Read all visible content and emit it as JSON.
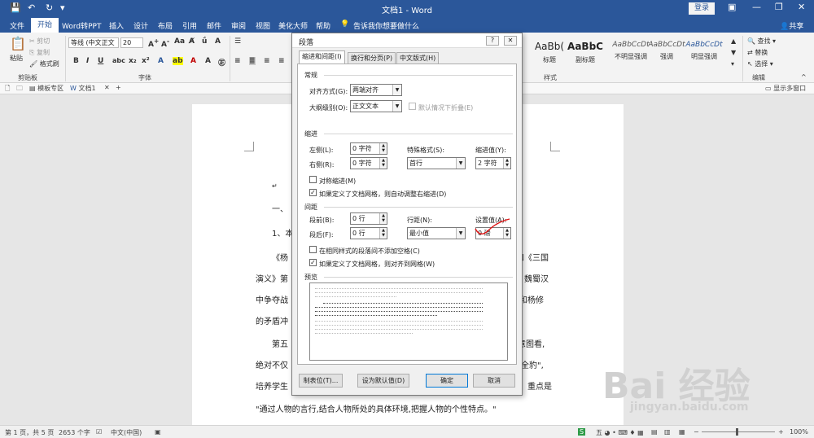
{
  "titlebar": {
    "title": "文档1 - Word",
    "login": "登录"
  },
  "ribbon_tabs": [
    "文件",
    "开始",
    "Word转PPT",
    "插入",
    "设计",
    "布局",
    "引用",
    "邮件",
    "审阅",
    "视图",
    "美化大师",
    "帮助"
  ],
  "tell_me": "告诉我你想要做什么",
  "share": "共享",
  "ribbon": {
    "paste": "粘贴",
    "cut": "剪切",
    "copy": "复制",
    "format_painter": "格式刷",
    "clipboard_label": "剪贴板",
    "font_name": "等线 (中文正文",
    "font_size": "20",
    "font_label": "字体",
    "styles_label": "样式",
    "edit_label": "编辑",
    "find": "查找",
    "replace": "替换",
    "select": "选择",
    "styles": [
      {
        "sample": "AaBb(",
        "name": "标题"
      },
      {
        "sample": "AaBbC",
        "name": "副标题"
      },
      {
        "sample": "AaBbCcDt",
        "name": "不明显强调"
      },
      {
        "sample": "AaBbCcDt",
        "name": "强调"
      },
      {
        "sample": "AaBbCcDt",
        "name": "明显强调"
      }
    ]
  },
  "docbar": {
    "templates": "模板专区",
    "doc": "文档1",
    "multi_window": "显示多窗口"
  },
  "document": {
    "l1": "一、",
    "l2": "1、本",
    "l3a": "《杨",
    "l3b": "和《三国",
    "l4a": "演义》第",
    "l4b": "魏蜀汉",
    "l5a": "中争夺战",
    "l5b": "和杨修",
    "l6a": "的矛盾冲",
    "l7a": "第五",
    "l7b": "意图看,",
    "l8a": "绝对不仅",
    "l8b": "全豹\",",
    "l9a": "培养学生",
    "l9b": "重点是",
    "l10": "\"通过人物的言行,结合人物所处的具体环境,把握人物的个性特点。\""
  },
  "dialog": {
    "title": "段落",
    "help": "?",
    "close": "✕",
    "tabs": [
      "缩进和间距(I)",
      "换行和分页(P)",
      "中文版式(H)"
    ],
    "general_label": "常规",
    "alignment_label": "对齐方式(G):",
    "alignment_value": "两端对齐",
    "outline_label": "大纲级别(O):",
    "outline_value": "正文文本",
    "collapse_label": "默认情况下折叠(E)",
    "indent_label": "缩进",
    "left_label": "左侧(L):",
    "left_value": "0 字符",
    "right_label": "右侧(R):",
    "right_value": "0 字符",
    "special_label": "特殊格式(S):",
    "special_value": "首行",
    "indent_value_label": "缩进值(Y):",
    "indent_value": "2 字符",
    "mirror_label": "对称缩进(M)",
    "auto_right_label": "如果定义了文档网格，则自动调整右缩进(D)",
    "spacing_label": "间距",
    "before_label": "段前(B):",
    "before_value": "0 行",
    "after_label": "段后(F):",
    "after_value": "0 行",
    "line_spacing_label": "行距(N):",
    "line_spacing_value": "最小值",
    "set_value_label": "设置值(A):",
    "set_value": "0 磅",
    "no_space_label": "在相同样式的段落间不添加空格(C)",
    "snap_grid_label": "如果定义了文档网格，则对齐到网格(W)",
    "preview_label": "预览",
    "tabs_btn": "制表位(T)...",
    "default_btn": "设为默认值(D)",
    "ok_btn": "确定",
    "cancel_btn": "取消"
  },
  "statusbar": {
    "page": "第 1 页，共 5 页",
    "words": "2653 个字",
    "lang": "中文(中国)",
    "zoom": "100%"
  },
  "watermark": {
    "brand": "Bai 经验",
    "url": "jingyan.baidu.com"
  }
}
